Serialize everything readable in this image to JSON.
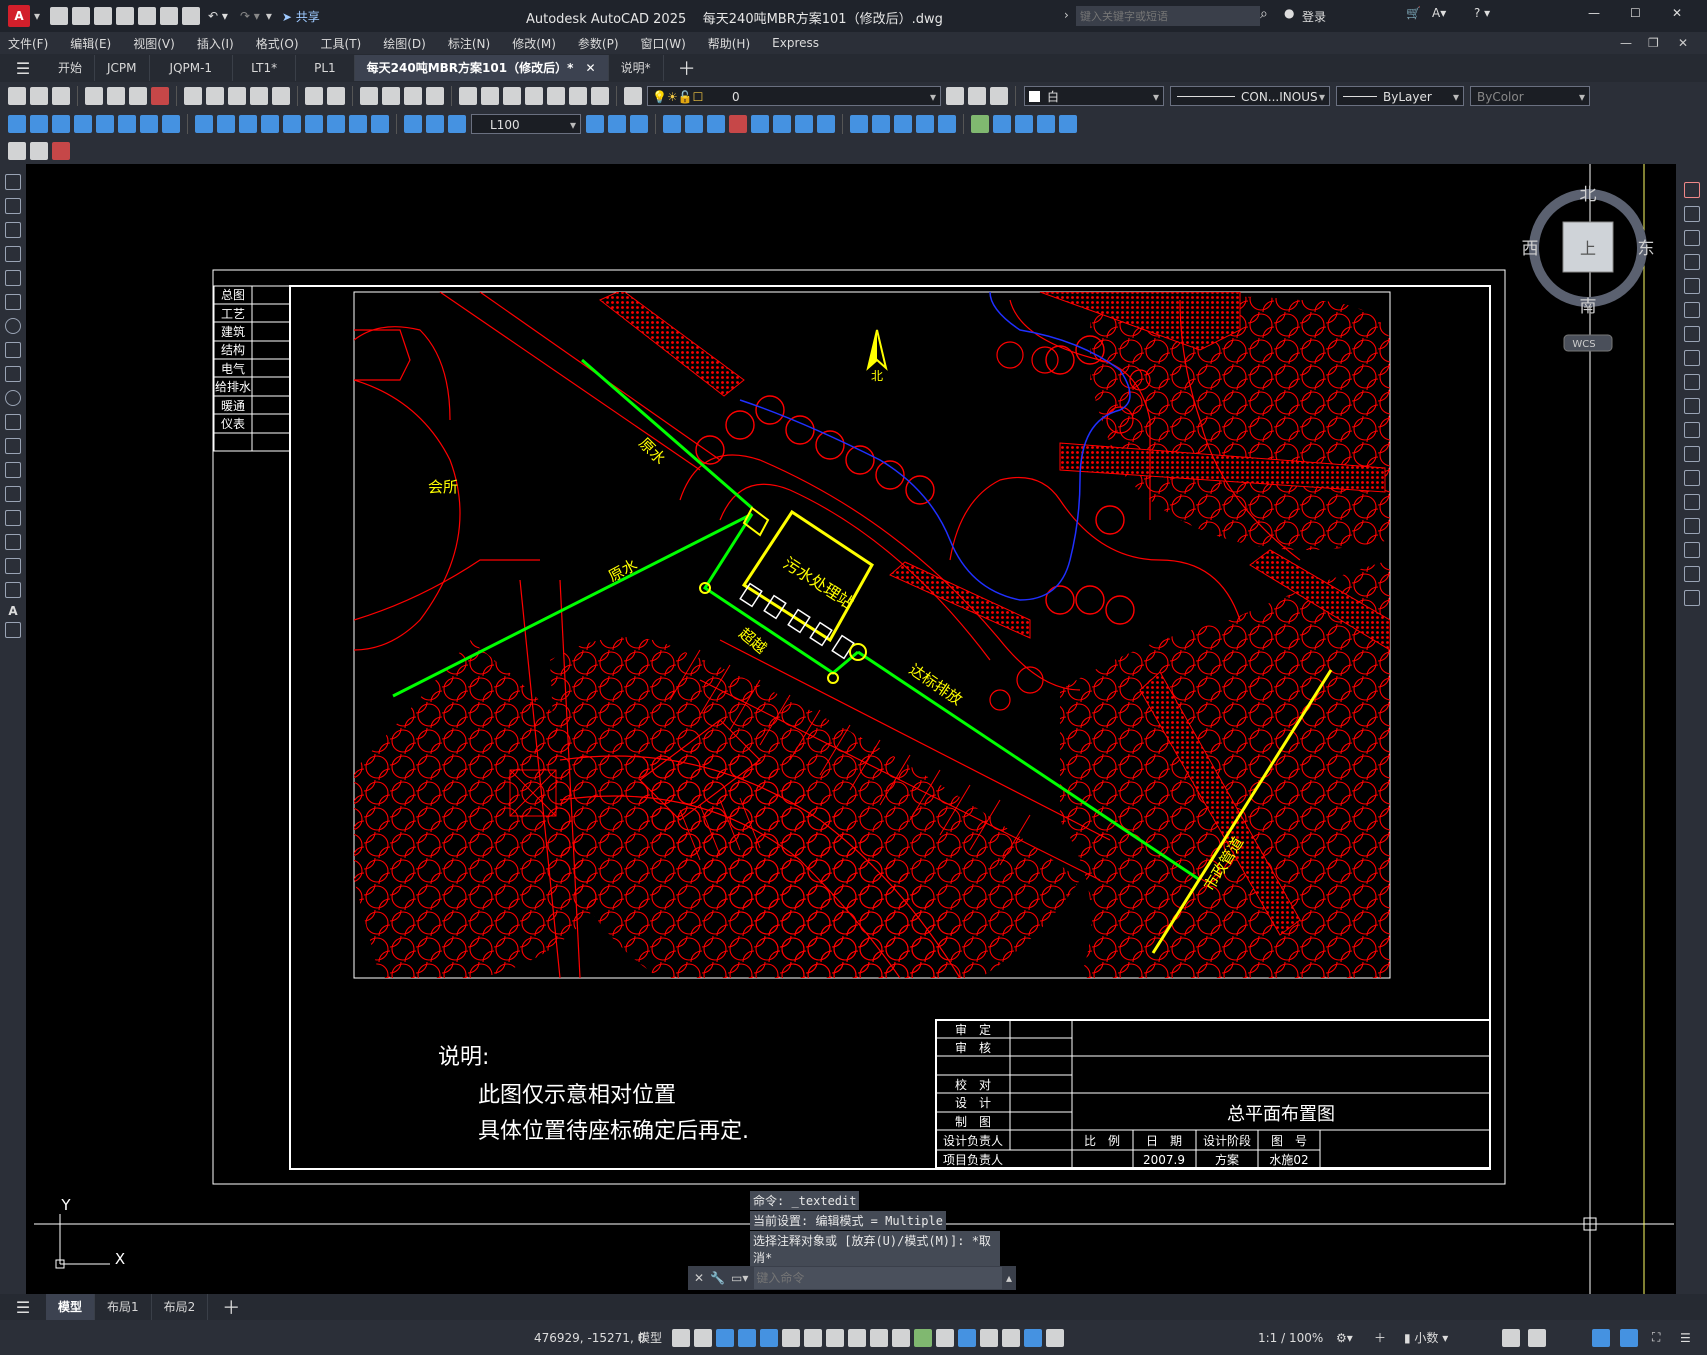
{
  "titlebar": {
    "app_letter": "A",
    "share_label": "共享",
    "title": "Autodesk AutoCAD 2025    每天240吨MBR方案101（修改后）.dwg",
    "search_placeholder": "键入关键字或短语",
    "login_label": "登录"
  },
  "menu": [
    "文件(F)",
    "编辑(E)",
    "视图(V)",
    "插入(I)",
    "格式(O)",
    "工具(T)",
    "绘图(D)",
    "标注(N)",
    "修改(M)",
    "参数(P)",
    "窗口(W)",
    "帮助(H)",
    "Express"
  ],
  "tabs": [
    {
      "label": "开始"
    },
    {
      "label": "JCPM"
    },
    {
      "label": "JQPM-1"
    },
    {
      "label": "LT1*"
    },
    {
      "label": "PL1"
    },
    {
      "label": "每天240吨MBR方案101（修改后）*"
    },
    {
      "label": "说明*"
    }
  ],
  "toolbar": {
    "layer_value": "0",
    "color_value": "白",
    "linetype_value": "CON...INOUS",
    "lineweight_value": "ByLayer",
    "plotstyle_value": "ByColor",
    "dimstyle_value": "L100"
  },
  "viewcube": {
    "north": "北",
    "south": "南",
    "east": "东",
    "west": "西",
    "face": "上",
    "wcs": "WCS"
  },
  "drawing": {
    "side_table": [
      "总图",
      "工艺",
      "建筑",
      "结构",
      "电气",
      "给排水",
      "暖通",
      "仪表"
    ],
    "label_clubhouse": "会所",
    "label_raw_water_1": "原水",
    "label_raw_water_2": "原水",
    "label_station": "污水处理站",
    "label_overflow": "超越",
    "label_discharge": "达标排放",
    "label_municipal": "市政管道",
    "north_label": "北",
    "note_title": "说明:",
    "note_line1": "此图仅示意相对位置",
    "note_line2": "具体位置待座标确定后再定.",
    "title_block": {
      "rows": [
        "审　定",
        "审　核",
        "",
        "校　对",
        "设　计",
        "制　图",
        "设计负责人",
        "项目负责人"
      ],
      "drawing_title": "总平面布置图",
      "hdr_scale": "比　例",
      "hdr_date": "日　期",
      "hdr_stage": "设计阶段",
      "hdr_number": "图　号",
      "date": "2007.9",
      "stage": "方案",
      "number": "水施02"
    },
    "ucs_x": "X",
    "ucs_y": "Y"
  },
  "command_history": [
    "命令: _textedit",
    "当前设置: 编辑模式 = Multiple",
    "选择注释对象或 [放弃(U)/模式(M)]: *取消*"
  ],
  "command_placeholder": "键入命令",
  "layout_tabs": [
    {
      "label": "模型"
    },
    {
      "label": "布局1"
    },
    {
      "label": "布局2"
    }
  ],
  "status": {
    "coords": "476929, -15271, 0",
    "model": "模型",
    "scale": "1:1 / 100%",
    "units": "小数"
  },
  "colors": {
    "red": "#ff0000",
    "yellow": "#ffff00",
    "green": "#00ff00",
    "blue": "#2030ff",
    "white": "#ffffff"
  }
}
